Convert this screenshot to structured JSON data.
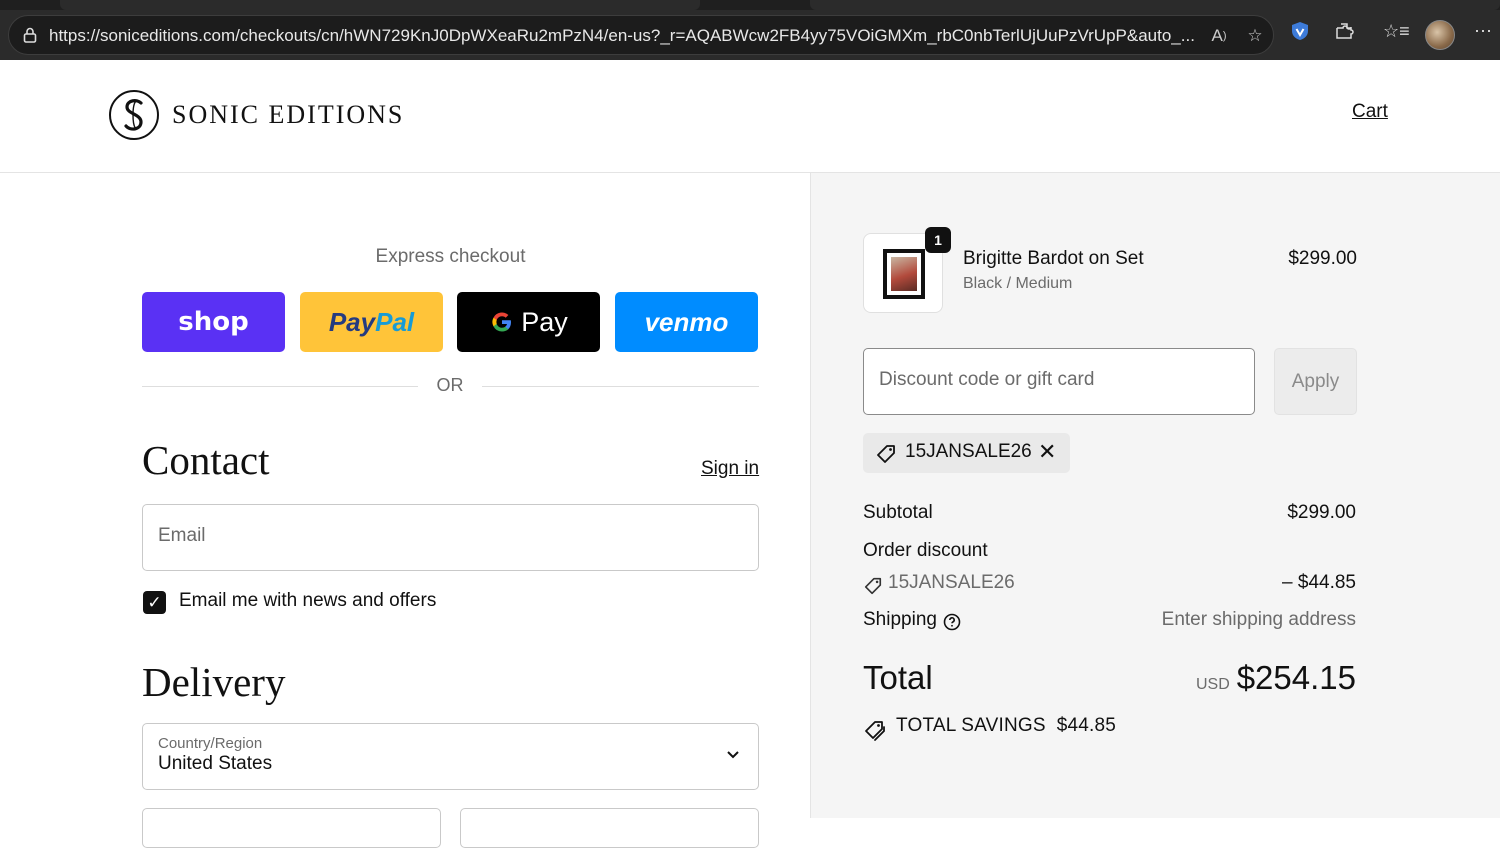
{
  "browser": {
    "url": "https://soniceditions.com/checkouts/cn/hWN729KnJ0DpWXeaRu2mPzN4/en-us?_r=AQABWcw2FB4yy75VOiGMXm_rbC0nbTerlUjUuPzVrUpP&auto_..."
  },
  "header": {
    "brand": "SONIC EDITIONS",
    "cart_label": "Cart"
  },
  "checkout": {
    "express_title": "Express checkout",
    "express_buttons": {
      "shop": "shop",
      "paypal": "PayPal",
      "gpay": "Pay",
      "venmo": "venmo"
    },
    "or_label": "OR",
    "contact": {
      "heading": "Contact",
      "sign_in": "Sign in",
      "email_placeholder": "Email",
      "newsletter_label": "Email me with news and offers",
      "newsletter_checked": true
    },
    "delivery": {
      "heading": "Delivery",
      "country_label": "Country/Region",
      "country_value": "United States"
    }
  },
  "summary": {
    "product": {
      "quantity": "1",
      "name": "Brigitte Bardot on Set",
      "variant": "Black / Medium",
      "price": "$299.00"
    },
    "discount_placeholder": "Discount code or gift card",
    "apply_label": "Apply",
    "applied_code": "15JANSALE26",
    "subtotal_label": "Subtotal",
    "subtotal_value": "$299.00",
    "order_discount_label": "Order discount",
    "discount_code": "15JANSALE26",
    "discount_value": "– $44.85",
    "shipping_label": "Shipping",
    "shipping_value": "Enter shipping address",
    "total_label": "Total",
    "total_currency": "USD",
    "total_value": "$254.15",
    "savings_label": "TOTAL SAVINGS",
    "savings_value": "$44.85"
  }
}
